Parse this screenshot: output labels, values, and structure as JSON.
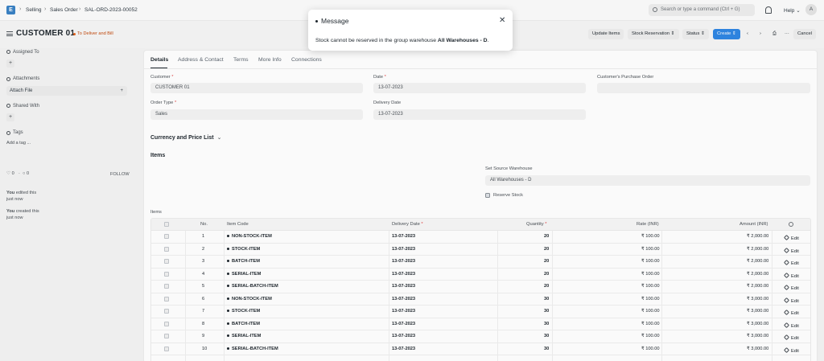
{
  "nav": {
    "logo_letter": "E",
    "breadcrumbs": [
      "Selling",
      "Sales Order",
      "SAL-ORD-2023-00052"
    ],
    "search_placeholder": "Search or type a command (Ctrl + G)",
    "help_label": "Help",
    "avatar_letter": "A"
  },
  "header": {
    "title": "CUSTOMER 01",
    "status": "To Deliver and Bill",
    "status_color": "#e2621b",
    "buttons": {
      "update_items": "Update Items",
      "stock_reservation": "Stock Reservation",
      "status": "Status",
      "create": "Create",
      "prev": "‹",
      "next": "›",
      "print": "⎙",
      "more": "···",
      "cancel": "Cancel"
    }
  },
  "sidebar": {
    "assigned_to": "Assigned To",
    "attachments": "Attachments",
    "attach_file": "Attach File",
    "shared_with": "Shared With",
    "tags": "Tags",
    "add_tag": "Add a tag ...",
    "likes": "0",
    "comments": "0",
    "follow": "FOLLOW",
    "activity": [
      {
        "user": "You",
        "action": "edited this",
        "time": "just now"
      },
      {
        "user": "You",
        "action": "created this",
        "time": "just now"
      }
    ]
  },
  "tabs": [
    "Details",
    "Address & Contact",
    "Terms",
    "More Info",
    "Connections"
  ],
  "form": {
    "customer_label": "Customer",
    "customer_value": "CUSTOMER 01",
    "date_label": "Date",
    "date_value": "13-07-2023",
    "po_label": "Customer's Purchase Order",
    "order_type_label": "Order Type",
    "order_type_value": "Sales",
    "delivery_date_label": "Delivery Date",
    "delivery_date_value": "13-07-2023",
    "currency_section": "Currency and Price List",
    "items_section": "Items",
    "source_wh_label": "Set Source Warehouse",
    "source_wh_value": "All Warehouses - D",
    "reserve_stock_label": "Reserve Stock",
    "items_table_label": "Items"
  },
  "table": {
    "headers": {
      "no": "No.",
      "item_code": "Item Code",
      "delivery_date": "Delivery Date",
      "quantity": "Quantity",
      "rate": "Rate (INR)",
      "amount": "Amount (INR)"
    },
    "edit_label": "Edit",
    "rows": [
      {
        "no": "1",
        "item": "NON-STOCK-ITEM",
        "date": "13-07-2023",
        "qty": "20",
        "rate": "₹ 100.00",
        "amount": "₹ 2,000.00"
      },
      {
        "no": "2",
        "item": "STOCK-ITEM",
        "date": "13-07-2023",
        "qty": "20",
        "rate": "₹ 100.00",
        "amount": "₹ 2,000.00"
      },
      {
        "no": "3",
        "item": "BATCH-ITEM",
        "date": "13-07-2023",
        "qty": "20",
        "rate": "₹ 100.00",
        "amount": "₹ 2,000.00"
      },
      {
        "no": "4",
        "item": "SERIAL-ITEM",
        "date": "13-07-2023",
        "qty": "20",
        "rate": "₹ 100.00",
        "amount": "₹ 2,000.00"
      },
      {
        "no": "5",
        "item": "SERIAL-BATCH-ITEM",
        "date": "13-07-2023",
        "qty": "20",
        "rate": "₹ 100.00",
        "amount": "₹ 2,000.00"
      },
      {
        "no": "6",
        "item": "NON-STOCK-ITEM",
        "date": "13-07-2023",
        "qty": "30",
        "rate": "₹ 100.00",
        "amount": "₹ 3,000.00"
      },
      {
        "no": "7",
        "item": "STOCK-ITEM",
        "date": "13-07-2023",
        "qty": "30",
        "rate": "₹ 100.00",
        "amount": "₹ 3,000.00"
      },
      {
        "no": "8",
        "item": "BATCH-ITEM",
        "date": "13-07-2023",
        "qty": "30",
        "rate": "₹ 100.00",
        "amount": "₹ 3,000.00"
      },
      {
        "no": "9",
        "item": "SERIAL-ITEM",
        "date": "13-07-2023",
        "qty": "30",
        "rate": "₹ 100.00",
        "amount": "₹ 3,000.00"
      },
      {
        "no": "10",
        "item": "SERIAL-BATCH-ITEM",
        "date": "13-07-2023",
        "qty": "30",
        "rate": "₹ 100.00",
        "amount": "₹ 3,000.00"
      }
    ]
  },
  "modal": {
    "title": "Message",
    "close": "✕",
    "message_prefix": "Stock cannot be reserved in the group warehouse",
    "message_warehouse": "All Warehouses - D",
    "message_suffix": "."
  }
}
